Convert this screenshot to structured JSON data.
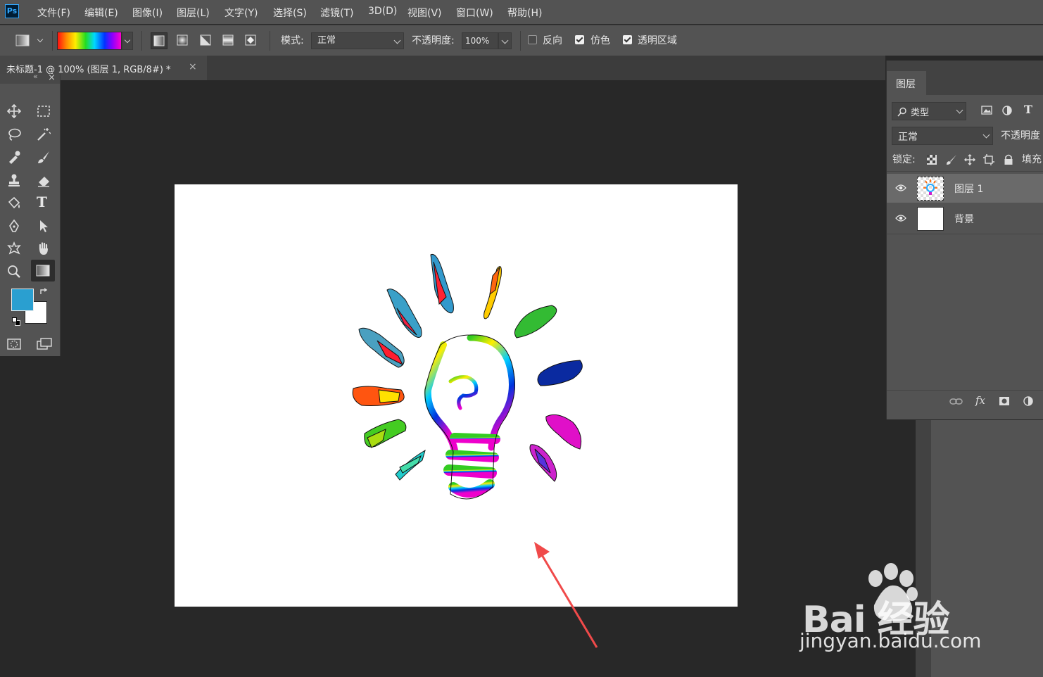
{
  "app": {
    "logo": "Ps"
  },
  "menu": [
    "文件(F)",
    "编辑(E)",
    "图像(I)",
    "图层(L)",
    "文字(Y)",
    "选择(S)",
    "滤镜(T)",
    "3D(D)",
    "视图(V)",
    "窗口(W)",
    "帮助(H)"
  ],
  "options": {
    "mode_label": "模式:",
    "mode_value": "正常",
    "opacity_label": "不透明度:",
    "opacity_value": "100%",
    "reverse_label": "反向",
    "reverse_checked": false,
    "dither_label": "仿色",
    "dither_checked": true,
    "transparency_label": "透明区域",
    "transparency_checked": true
  },
  "document": {
    "tab_title": "未标题-1 @ 100% (图层 1, RGB/8#) *",
    "close": "×"
  },
  "toolbox": {
    "close": "×",
    "foreground_color": "#2a9fd0",
    "background_color": "#ffffff",
    "type_tool_glyph": "T"
  },
  "layers_panel": {
    "tab": "图层",
    "filter_label": "类型",
    "blend_mode": "正常",
    "opacity_label": "不透明度",
    "lock_label": "锁定:",
    "fill_label": "填充",
    "type_filter_glyph": "T",
    "fx_label": "fx",
    "layers": [
      {
        "name": "图层 1",
        "selected": true
      },
      {
        "name": "背景",
        "selected": false
      }
    ]
  },
  "watermark": {
    "brand": "Bai 经验",
    "url": "jingyan.baidu.com"
  },
  "colors": {
    "accent_arrow": "#f04a4a",
    "ui_bg": "#535353",
    "workspace": "#282828"
  }
}
